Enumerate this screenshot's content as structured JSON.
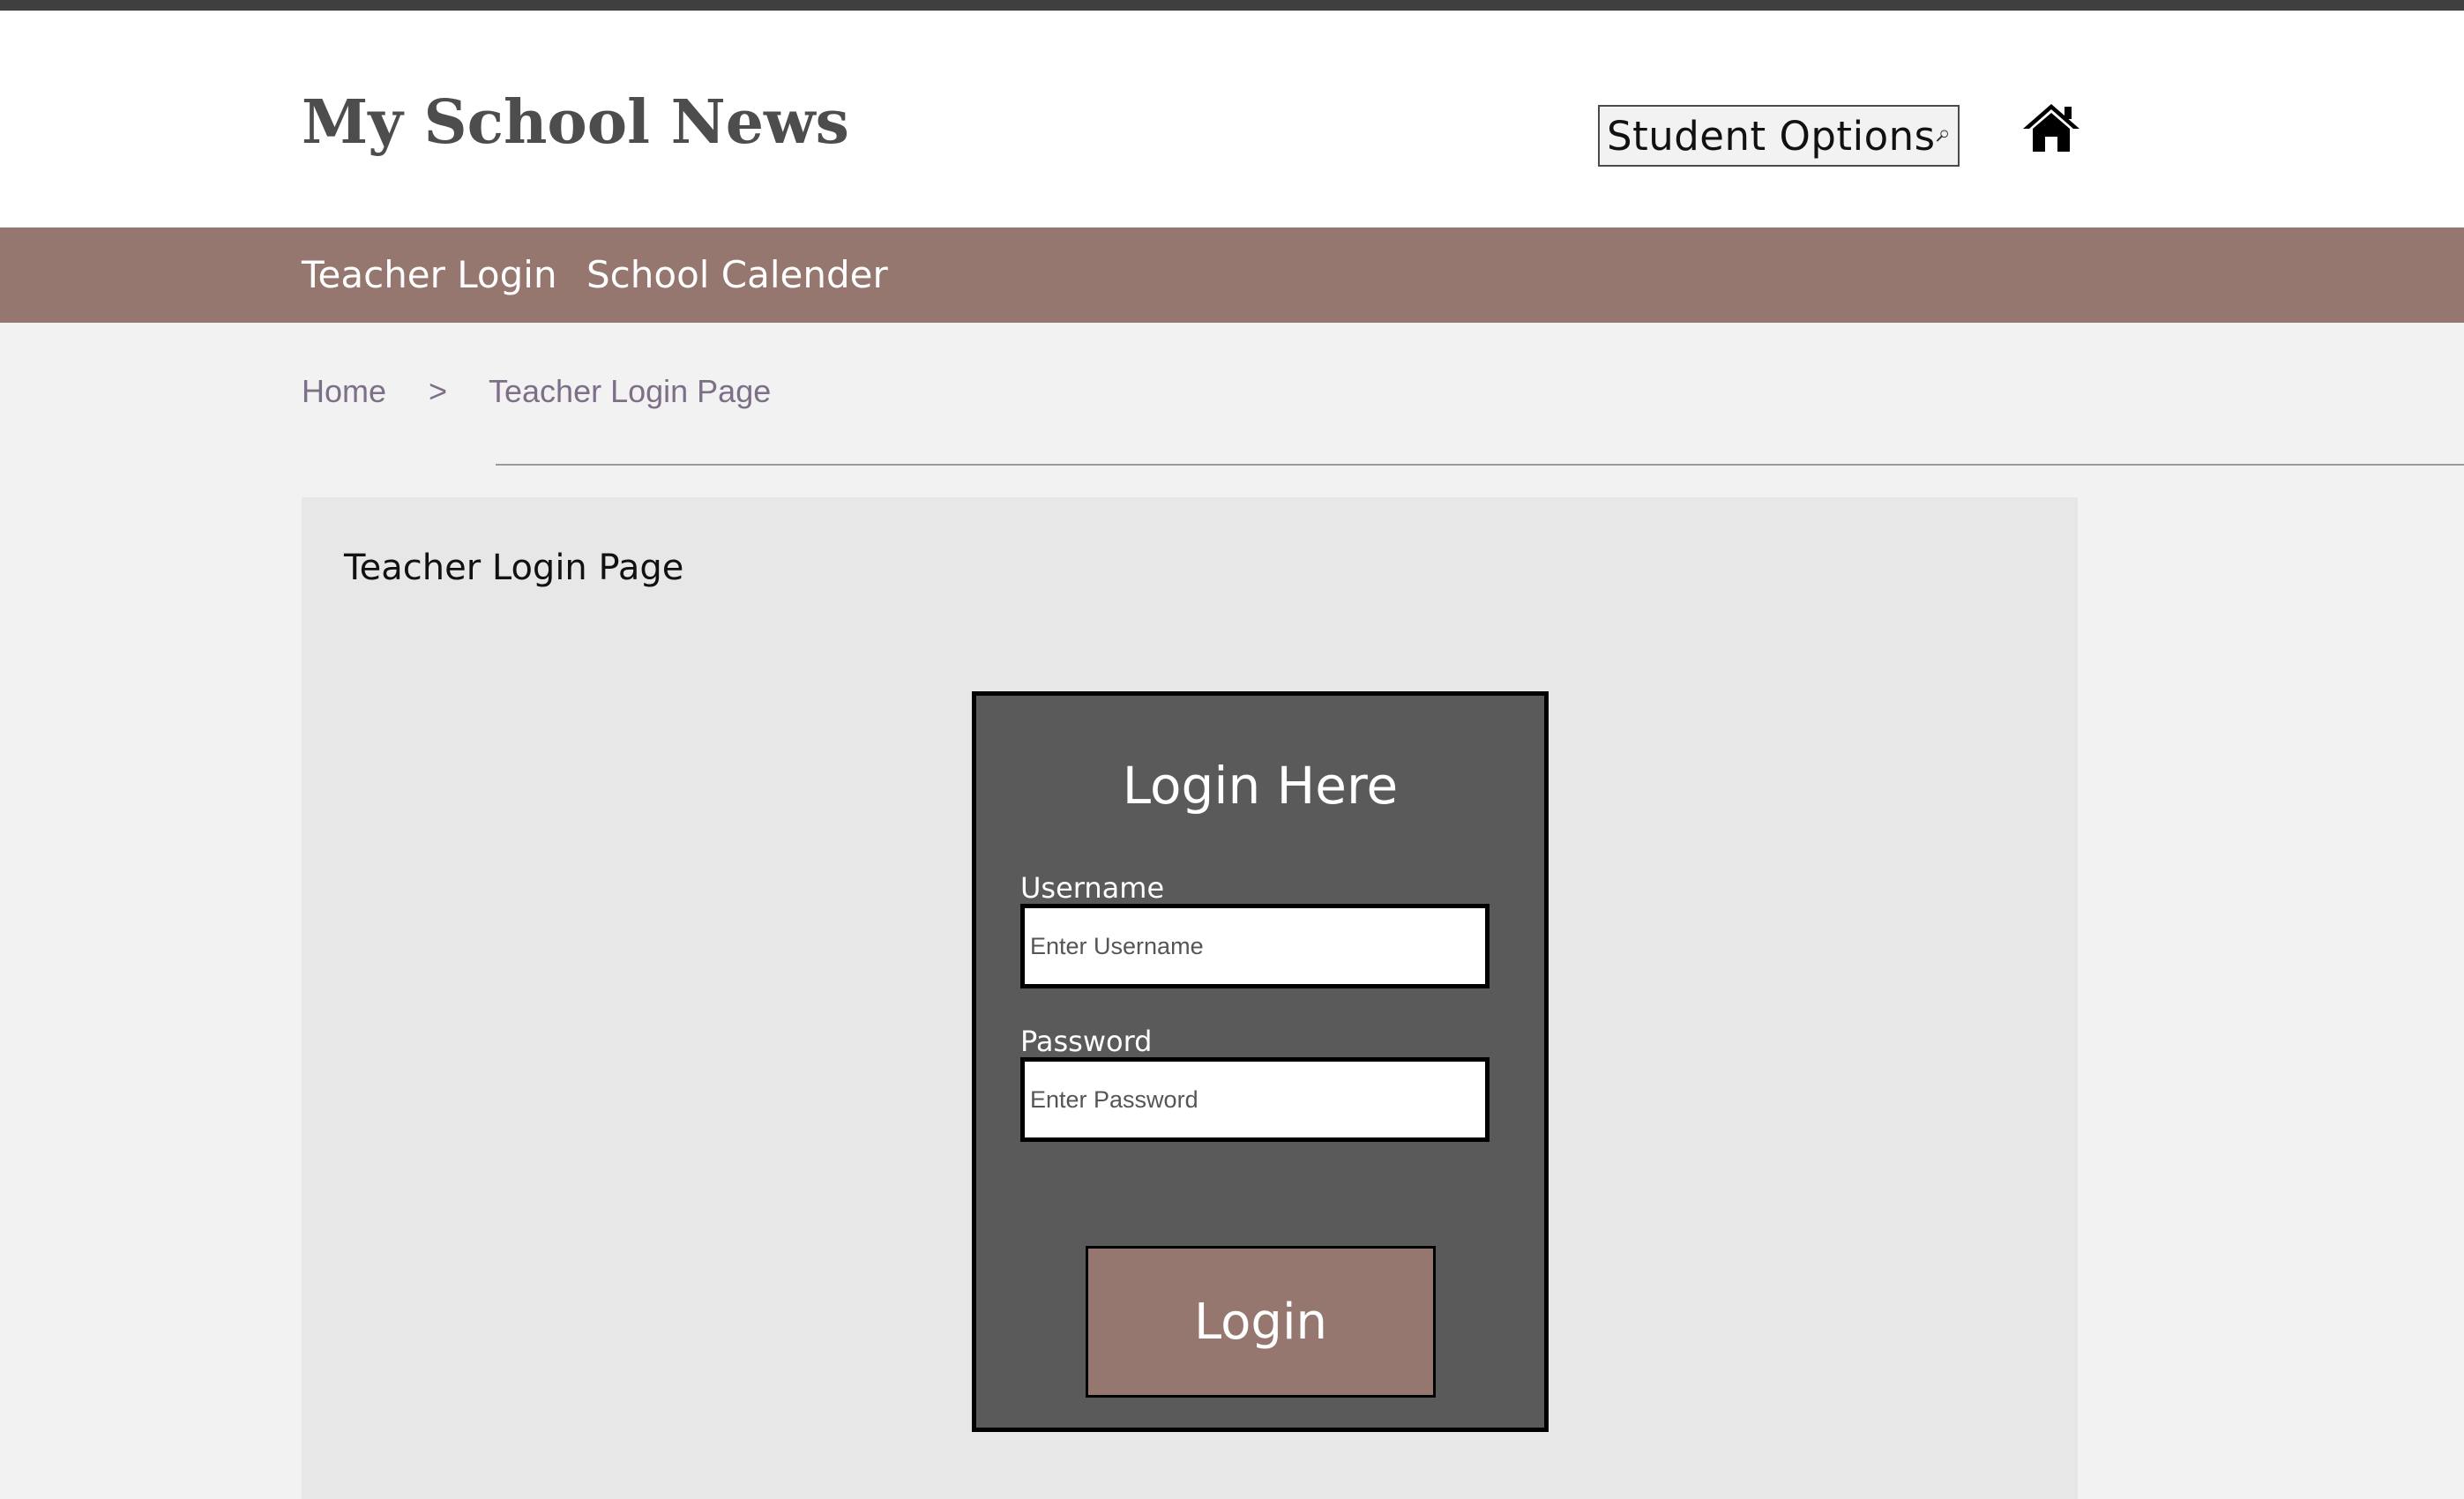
{
  "header": {
    "site_title": "My School News",
    "student_options_label": "Student Options",
    "search_icon": "magnifying-glass-icon",
    "home_icon": "house-icon"
  },
  "nav": {
    "items": [
      {
        "label": "Teacher Login"
      },
      {
        "label": "School Calender"
      }
    ]
  },
  "breadcrumb": {
    "home": "Home",
    "separator": ">",
    "current": "Teacher Login Page"
  },
  "main": {
    "panel_title": "Teacher Login Page",
    "login": {
      "heading": "Login Here",
      "username_label": "Username",
      "username_placeholder": "Enter Username",
      "username_value": "",
      "password_label": "Password",
      "password_placeholder": "Enter Password",
      "password_value": "",
      "button_label": "Login"
    }
  },
  "colors": {
    "top_strip": "#3f3f3f",
    "nav_background": "#96776f",
    "login_box_background": "#5a5a5a",
    "login_button_background": "#96776f",
    "breadcrumb_text": "#7d6f88",
    "page_background": "#f2f2f2",
    "panel_background": "#e7e7e7"
  }
}
